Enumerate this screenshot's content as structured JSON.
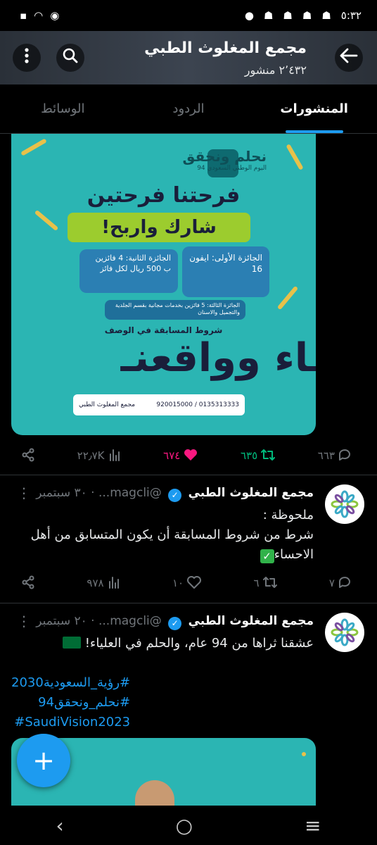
{
  "status_bar": {
    "time": "٥:٣٢",
    "left_icons": [
      "record-icon",
      "wifi-icon",
      "photo-icon"
    ],
    "right_icons": [
      "snapchat-icon",
      "snapchat-icon",
      "snapchat-icon",
      "snapchat-icon",
      "dot-icon"
    ]
  },
  "header": {
    "title": "مجمع المغلوث الطبي",
    "subtitle": "٢٬٤٣٢ منشور"
  },
  "tabs": [
    {
      "label": "المنشورات",
      "active": true
    },
    {
      "label": "الردود",
      "active": false
    },
    {
      "label": "الوسائط",
      "active": false
    }
  ],
  "promo": {
    "logo_title": "نحلم ونحقق",
    "logo_subtitle": "اليوم الوطني السعودي 94",
    "headline": "فرحتنا فرحتين",
    "cta": "شارك واربح!",
    "prize_first": "الجائزة الأولى: ايفون 16",
    "prize_second": "الجائزة الثانية: 4 فائزين ب 500 ريال لكل فائز",
    "prize_third": "الجائزة الثالثة: 5 فائزين بخدمات مجانية بقسم الجلدية والتجميل والاسنان",
    "terms": "شروط المسابقة في الوصف",
    "big_text": "ـاء وواقعنـ",
    "contact_phones": "0135313333 / 920015000",
    "contact_brand": "مجمع المغلوث الطبي"
  },
  "tweet0_actions": {
    "replies": "٦٦٣",
    "retweets": "٦٣٥",
    "likes": "٦٧٤",
    "views": "٢٢٫٧K"
  },
  "tweet1": {
    "name": "مجمع المغلوث الطبي",
    "handle": "@magcli...",
    "time": "٣٠ سبتمبر",
    "line1": "ملحوظة :",
    "line2": "شرط من شروط المسابقة أن يكون المتسابق من أهل الاحساء",
    "replies": "٧",
    "retweets": "٦",
    "likes": "١٠",
    "views": "٩٧٨"
  },
  "tweet2": {
    "name": "مجمع المغلوث الطبي",
    "handle": "@magcli...",
    "time": "٢٠ سبتمبر",
    "text": "عشقنا ثراها من 94 عام، والحلم في العلياء!",
    "hashtag1": "#رؤية_السعودية2030",
    "hashtag2": "#نحلم_ونحقق94",
    "hashtag3": "#SaudiVision2023"
  },
  "colors": {
    "accent": "#1d9bf0",
    "retweet": "#00ba7c",
    "like": "#f91880",
    "promo_bg": "#2bb5b3"
  }
}
